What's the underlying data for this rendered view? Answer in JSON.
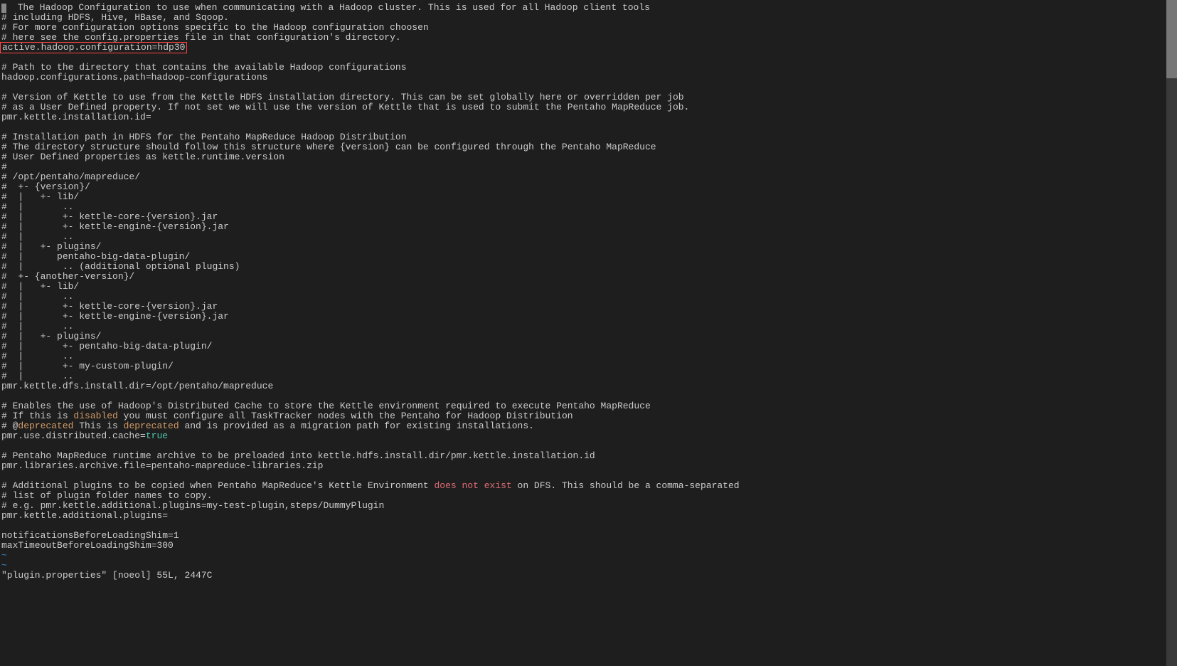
{
  "editor": {
    "lines": [
      {
        "t": "plain",
        "text": "  The Hadoop Configuration to use when communicating with a Hadoop cluster. This is used for all Hadoop client tools",
        "cursor": true
      },
      {
        "t": "plain",
        "text": "# including HDFS, Hive, HBase, and Sqoop."
      },
      {
        "t": "plain",
        "text": "# For more configuration options specific to the Hadoop configuration choosen"
      },
      {
        "t": "plain",
        "text": "# here see the config.properties file in that configuration's directory."
      },
      {
        "t": "highlight",
        "text": "active.hadoop.configuration=hdp30"
      },
      {
        "t": "plain",
        "text": ""
      },
      {
        "t": "plain",
        "text": "# Path to the directory that contains the available Hadoop configurations"
      },
      {
        "t": "plain",
        "text": "hadoop.configurations.path=hadoop-configurations"
      },
      {
        "t": "plain",
        "text": ""
      },
      {
        "t": "plain",
        "text": "# Version of Kettle to use from the Kettle HDFS installation directory. This can be set globally here or overridden per job"
      },
      {
        "t": "plain",
        "text": "# as a User Defined property. If not set we will use the version of Kettle that is used to submit the Pentaho MapReduce job."
      },
      {
        "t": "plain",
        "text": "pmr.kettle.installation.id="
      },
      {
        "t": "plain",
        "text": ""
      },
      {
        "t": "plain",
        "text": "# Installation path in HDFS for the Pentaho MapReduce Hadoop Distribution"
      },
      {
        "t": "plain",
        "text": "# The directory structure should follow this structure where {version} can be configured through the Pentaho MapReduce"
      },
      {
        "t": "plain",
        "text": "# User Defined properties as kettle.runtime.version"
      },
      {
        "t": "plain",
        "text": "#"
      },
      {
        "t": "plain",
        "text": "# /opt/pentaho/mapreduce/"
      },
      {
        "t": "plain",
        "text": "#  +- {version}/"
      },
      {
        "t": "plain",
        "text": "#  |   +- lib/"
      },
      {
        "t": "plain",
        "text": "#  |       .."
      },
      {
        "t": "plain",
        "text": "#  |       +- kettle-core-{version}.jar"
      },
      {
        "t": "plain",
        "text": "#  |       +- kettle-engine-{version}.jar"
      },
      {
        "t": "plain",
        "text": "#  |       .."
      },
      {
        "t": "plain",
        "text": "#  |   +- plugins/"
      },
      {
        "t": "plain",
        "text": "#  |      pentaho-big-data-plugin/"
      },
      {
        "t": "plain",
        "text": "#  |       .. (additional optional plugins)"
      },
      {
        "t": "plain",
        "text": "#  +- {another-version}/"
      },
      {
        "t": "plain",
        "text": "#  |   +- lib/"
      },
      {
        "t": "plain",
        "text": "#  |       .."
      },
      {
        "t": "plain",
        "text": "#  |       +- kettle-core-{version}.jar"
      },
      {
        "t": "plain",
        "text": "#  |       +- kettle-engine-{version}.jar"
      },
      {
        "t": "plain",
        "text": "#  |       .."
      },
      {
        "t": "plain",
        "text": "#  |   +- plugins/"
      },
      {
        "t": "plain",
        "text": "#  |       +- pentaho-big-data-plugin/"
      },
      {
        "t": "plain",
        "text": "#  |       .."
      },
      {
        "t": "plain",
        "text": "#  |       +- my-custom-plugin/"
      },
      {
        "t": "plain",
        "text": "#  |       .."
      },
      {
        "t": "plain",
        "text": "pmr.kettle.dfs.install.dir=/opt/pentaho/mapreduce"
      },
      {
        "t": "plain",
        "text": ""
      },
      {
        "t": "plain",
        "text": "# Enables the use of Hadoop's Distributed Cache to store the Kettle environment required to execute Pentaho MapReduce"
      },
      {
        "t": "tokens",
        "parts": [
          {
            "cls": "",
            "txt": "# If this is "
          },
          {
            "cls": "keyword-disabled",
            "txt": "disabled"
          },
          {
            "cls": "",
            "txt": " you must configure all TaskTracker nodes with the Pentaho for Hadoop Distribution"
          }
        ]
      },
      {
        "t": "tokens",
        "parts": [
          {
            "cls": "",
            "txt": "# @"
          },
          {
            "cls": "keyword-deprecated",
            "txt": "deprecated"
          },
          {
            "cls": "",
            "txt": " This is "
          },
          {
            "cls": "keyword-deprecated",
            "txt": "deprecated"
          },
          {
            "cls": "",
            "txt": " and is provided as a migration path for existing installations."
          }
        ]
      },
      {
        "t": "tokens",
        "parts": [
          {
            "cls": "",
            "txt": "pmr.use.distributed.cache="
          },
          {
            "cls": "keyword-true",
            "txt": "true"
          }
        ]
      },
      {
        "t": "plain",
        "text": ""
      },
      {
        "t": "plain",
        "text": "# Pentaho MapReduce runtime archive to be preloaded into kettle.hdfs.install.dir/pmr.kettle.installation.id"
      },
      {
        "t": "plain",
        "text": "pmr.libraries.archive.file=pentaho-mapreduce-libraries.zip"
      },
      {
        "t": "plain",
        "text": ""
      },
      {
        "t": "tokens",
        "parts": [
          {
            "cls": "",
            "txt": "# Additional plugins to be copied when Pentaho MapReduce's Kettle Environment "
          },
          {
            "cls": "keyword-does-not-exist",
            "txt": "does not exist"
          },
          {
            "cls": "",
            "txt": " on DFS. This should be a comma-separated"
          }
        ]
      },
      {
        "t": "plain",
        "text": "# list of plugin folder names to copy."
      },
      {
        "t": "plain",
        "text": "# e.g. pmr.kettle.additional.plugins=my-test-plugin,steps/DummyPlugin"
      },
      {
        "t": "plain",
        "text": "pmr.kettle.additional.plugins="
      },
      {
        "t": "plain",
        "text": ""
      },
      {
        "t": "plain",
        "text": "notificationsBeforeLoadingShim=1"
      },
      {
        "t": "plain",
        "text": "maxTimeoutBeforeLoadingShim=300"
      },
      {
        "t": "tilde",
        "text": "~"
      },
      {
        "t": "tilde",
        "text": "~"
      }
    ],
    "status_line": "\"plugin.properties\" [noeol] 55L, 2447C"
  },
  "scroll": {
    "up_arrow": "▴"
  }
}
